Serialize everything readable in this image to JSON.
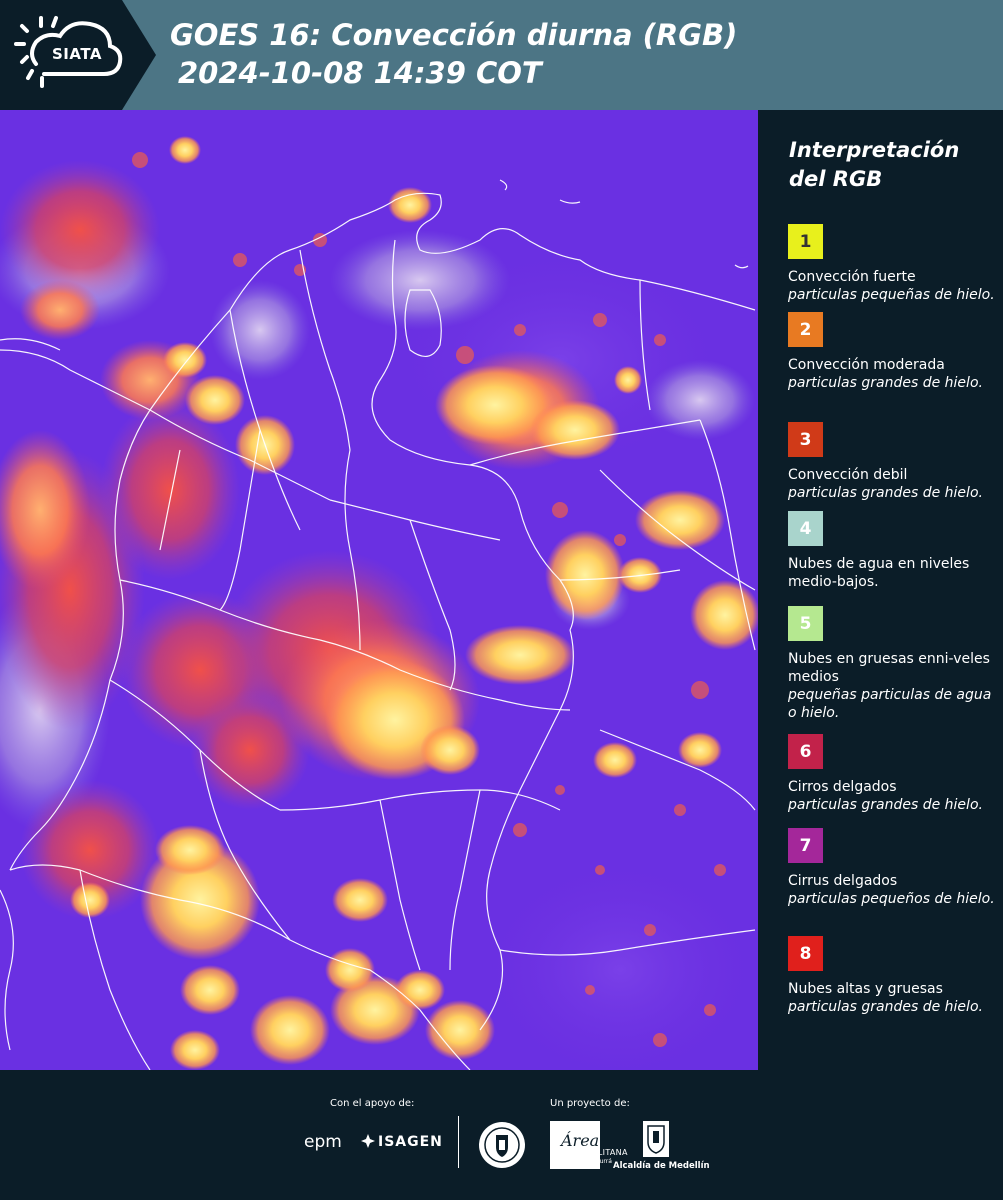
{
  "header": {
    "logo_text": "SIATA",
    "title_line1": "GOES 16: Convección diurna (RGB)",
    "title_line2": "2024-10-08 14:39 COT"
  },
  "legend": {
    "title": "Interpretación del RGB",
    "items": [
      {
        "number": "1",
        "color": "#e8f01c",
        "text_color": "#333333",
        "label": "Convección fuerte",
        "sub": "particulas pequeñas de hielo."
      },
      {
        "number": "2",
        "color": "#e87a22",
        "text_color": "#ffffff",
        "label": "Convección moderada",
        "sub": "particulas grandes de hielo."
      },
      {
        "number": "3",
        "color": "#d03a18",
        "text_color": "#ffffff",
        "label": "Convección debil",
        "sub": "particulas grandes de hielo."
      },
      {
        "number": "4",
        "color": "#a9d4cc",
        "text_color": "#ffffff",
        "label": "Nubes de agua en niveles medio-bajos.",
        "sub": ""
      },
      {
        "number": "5",
        "color": "#b5e890",
        "text_color": "#ffffff",
        "label": "Nubes en gruesas enni-veles medios",
        "sub": "pequeñas particulas de agua o hielo."
      },
      {
        "number": "6",
        "color": "#c2224a",
        "text_color": "#ffffff",
        "label": "Cirros delgados",
        "sub": "particulas grandes de hielo."
      },
      {
        "number": "7",
        "color": "#a4279a",
        "text_color": "#ffffff",
        "label": "Cirrus delgados",
        "sub": "particulas pequeños de hielo."
      },
      {
        "number": "8",
        "color": "#e0201c",
        "text_color": "#ffffff",
        "label": "Nubes altas y gruesas",
        "sub": "particulas grandes de hielo."
      }
    ]
  },
  "footer": {
    "support_label": "Con el apoyo de:",
    "project_label": "Un proyecto de:",
    "epm": "epm",
    "isagen": "ISAGEN",
    "area_name": "Área",
    "area_text": "METROPOLITANA",
    "area_sub": "Valle de Aburrá",
    "alcaldia": "Alcaldía de Medellín"
  }
}
